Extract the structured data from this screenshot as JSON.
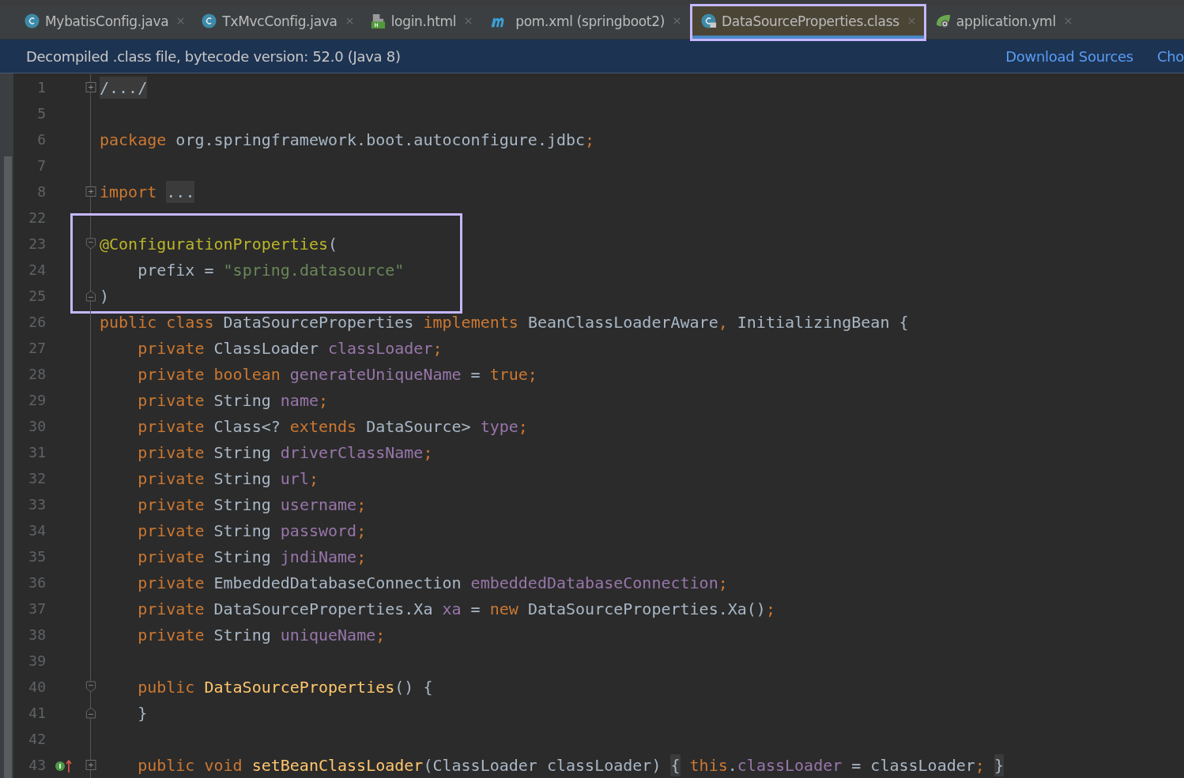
{
  "tabs": [
    {
      "label": "MybatisConfig.java",
      "kind": "class",
      "selected": false,
      "annotated": false
    },
    {
      "label": "TxMvcConfig.java",
      "kind": "class",
      "selected": false,
      "annotated": false
    },
    {
      "label": "login.html",
      "kind": "html",
      "selected": false,
      "annotated": false
    },
    {
      "label": "pom.xml (springboot2)",
      "kind": "maven",
      "selected": false,
      "annotated": false
    },
    {
      "label": "DataSourceProperties.class",
      "kind": "class-locked",
      "selected": true,
      "annotated": true
    },
    {
      "label": "application.yml",
      "kind": "spring",
      "selected": false,
      "annotated": false
    }
  ],
  "banner": {
    "message": "Decompiled .class file, bytecode version: 52.0 (Java 8)",
    "links": [
      "Download Sources",
      "Cho"
    ]
  },
  "code": {
    "blocks": [
      {
        "annotated": false,
        "lines": [
          {
            "number": "1",
            "fold": {
              "kind": "expand"
            },
            "tokens": [
              {
                "kind": "folded",
                "text": "/.../"
              }
            ]
          },
          {
            "number": "5"
          },
          {
            "number": "6",
            "tokens": [
              {
                "kind": "keyword",
                "text": "package"
              },
              {
                "kind": "plain",
                "text": " org.springframework.boot.autoconfigure.jdbc"
              },
              {
                "kind": "keyword",
                "text": ";"
              }
            ]
          },
          {
            "number": "7"
          },
          {
            "number": "8",
            "fold": {
              "kind": "expand"
            },
            "tokens": [
              {
                "kind": "keyword",
                "text": "import "
              },
              {
                "kind": "folded",
                "text": "..."
              }
            ]
          },
          {
            "number": "22"
          }
        ]
      },
      {
        "annotated": true,
        "lines": [
          {
            "number": "23",
            "fold": {
              "kind": "open"
            },
            "tokens": [
              {
                "kind": "annotation",
                "text": "@ConfigurationProperties"
              },
              {
                "kind": "plain",
                "text": "("
              }
            ]
          },
          {
            "number": "24",
            "tokens": [
              {
                "kind": "plain",
                "text": "    prefix = "
              },
              {
                "kind": "string",
                "text": "\"spring.datasource\""
              }
            ]
          },
          {
            "number": "25",
            "fold": {
              "kind": "close"
            },
            "tokens": [
              {
                "kind": "plain",
                "text": ")"
              }
            ]
          }
        ]
      },
      {
        "annotated": false,
        "lines": [
          {
            "number": "26",
            "tokens": [
              {
                "kind": "keyword",
                "text": "public class "
              },
              {
                "kind": "plain",
                "text": "DataSourceProperties "
              },
              {
                "kind": "keyword",
                "text": "implements "
              },
              {
                "kind": "plain",
                "text": "BeanClassLoaderAware"
              },
              {
                "kind": "keyword",
                "text": ","
              },
              {
                "kind": "plain",
                "text": " InitializingBean {"
              }
            ]
          },
          {
            "number": "27",
            "tokens": [
              {
                "kind": "keyword",
                "text": "    private "
              },
              {
                "kind": "plain",
                "text": "ClassLoader "
              },
              {
                "kind": "field",
                "text": "classLoader"
              },
              {
                "kind": "keyword",
                "text": ";"
              }
            ]
          },
          {
            "number": "28",
            "tokens": [
              {
                "kind": "keyword",
                "text": "    private boolean "
              },
              {
                "kind": "field",
                "text": "generateUniqueName"
              },
              {
                "kind": "plain",
                "text": " = "
              },
              {
                "kind": "keyword",
                "text": "true;"
              }
            ]
          },
          {
            "number": "29",
            "tokens": [
              {
                "kind": "keyword",
                "text": "    private "
              },
              {
                "kind": "plain",
                "text": "String "
              },
              {
                "kind": "field",
                "text": "name"
              },
              {
                "kind": "keyword",
                "text": ";"
              }
            ]
          },
          {
            "number": "30",
            "tokens": [
              {
                "kind": "keyword",
                "text": "    private "
              },
              {
                "kind": "plain",
                "text": "Class<? "
              },
              {
                "kind": "keyword",
                "text": "extends "
              },
              {
                "kind": "plain",
                "text": "DataSource> "
              },
              {
                "kind": "field",
                "text": "type"
              },
              {
                "kind": "keyword",
                "text": ";"
              }
            ]
          },
          {
            "number": "31",
            "tokens": [
              {
                "kind": "keyword",
                "text": "    private "
              },
              {
                "kind": "plain",
                "text": "String "
              },
              {
                "kind": "field",
                "text": "driverClassName"
              },
              {
                "kind": "keyword",
                "text": ";"
              }
            ]
          },
          {
            "number": "32",
            "tokens": [
              {
                "kind": "keyword",
                "text": "    private "
              },
              {
                "kind": "plain",
                "text": "String "
              },
              {
                "kind": "field",
                "text": "url"
              },
              {
                "kind": "keyword",
                "text": ";"
              }
            ]
          },
          {
            "number": "33",
            "tokens": [
              {
                "kind": "keyword",
                "text": "    private "
              },
              {
                "kind": "plain",
                "text": "String "
              },
              {
                "kind": "field",
                "text": "username"
              },
              {
                "kind": "keyword",
                "text": ";"
              }
            ]
          },
          {
            "number": "34",
            "tokens": [
              {
                "kind": "keyword",
                "text": "    private "
              },
              {
                "kind": "plain",
                "text": "String "
              },
              {
                "kind": "field",
                "text": "password"
              },
              {
                "kind": "keyword",
                "text": ";"
              }
            ]
          },
          {
            "number": "35",
            "tokens": [
              {
                "kind": "keyword",
                "text": "    private "
              },
              {
                "kind": "plain",
                "text": "String "
              },
              {
                "kind": "field",
                "text": "jndiName"
              },
              {
                "kind": "keyword",
                "text": ";"
              }
            ]
          },
          {
            "number": "36",
            "tokens": [
              {
                "kind": "keyword",
                "text": "    private "
              },
              {
                "kind": "plain",
                "text": "EmbeddedDatabaseConnection "
              },
              {
                "kind": "field",
                "text": "embeddedDatabaseConnection"
              },
              {
                "kind": "keyword",
                "text": ";"
              }
            ]
          },
          {
            "number": "37",
            "tokens": [
              {
                "kind": "keyword",
                "text": "    private "
              },
              {
                "kind": "plain",
                "text": "DataSourceProperties.Xa "
              },
              {
                "kind": "field",
                "text": "xa"
              },
              {
                "kind": "plain",
                "text": " = "
              },
              {
                "kind": "keyword",
                "text": "new "
              },
              {
                "kind": "plain",
                "text": "DataSourceProperties.Xa()"
              },
              {
                "kind": "keyword",
                "text": ";"
              }
            ]
          },
          {
            "number": "38",
            "tokens": [
              {
                "kind": "keyword",
                "text": "    private "
              },
              {
                "kind": "plain",
                "text": "String "
              },
              {
                "kind": "field",
                "text": "uniqueName"
              },
              {
                "kind": "keyword",
                "text": ";"
              }
            ]
          },
          {
            "number": "39"
          },
          {
            "number": "40",
            "fold": {
              "kind": "open"
            },
            "tokens": [
              {
                "kind": "keyword",
                "text": "    public "
              },
              {
                "kind": "method",
                "text": "DataSourceProperties"
              },
              {
                "kind": "plain",
                "text": "() {"
              }
            ]
          },
          {
            "number": "41",
            "fold": {
              "kind": "close"
            },
            "tokens": [
              {
                "kind": "plain",
                "text": "    }"
              }
            ]
          },
          {
            "number": "42"
          },
          {
            "number": "43",
            "marker": {
              "kind": "implements"
            },
            "fold": {
              "kind": "expand"
            },
            "tokens": [
              {
                "kind": "keyword",
                "text": "    public void "
              },
              {
                "kind": "method",
                "text": "setBeanClassLoader"
              },
              {
                "kind": "plain",
                "text": "(ClassLoader classLoader) "
              },
              {
                "kind": "folded",
                "text": "{"
              },
              {
                "kind": "keyword",
                "text": " this"
              },
              {
                "kind": "plain",
                "text": "."
              },
              {
                "kind": "field",
                "text": "classLoader"
              },
              {
                "kind": "plain",
                "text": " = classLoader"
              },
              {
                "kind": "keyword",
                "text": "; "
              },
              {
                "kind": "folded",
                "text": "}"
              }
            ]
          }
        ]
      }
    ]
  }
}
